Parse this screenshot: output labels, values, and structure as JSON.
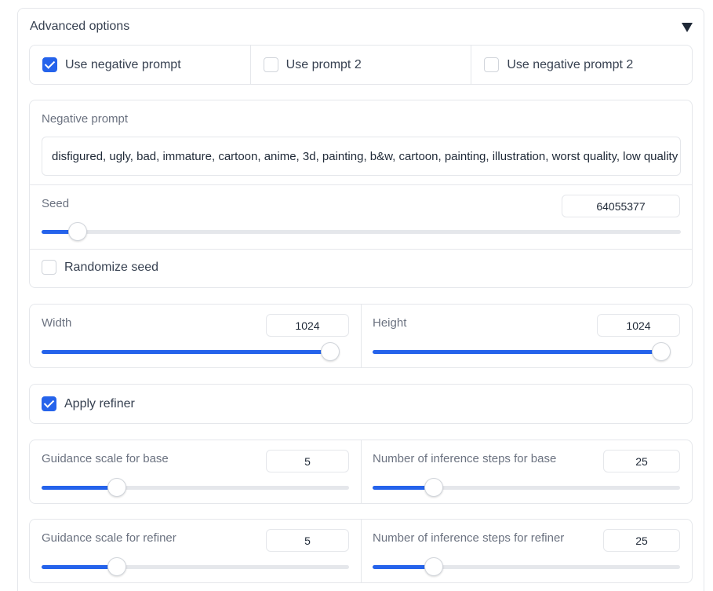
{
  "accordion": {
    "title": "Advanced options",
    "icon": "caret-down-icon"
  },
  "prompt_options": [
    {
      "label": "Use negative prompt",
      "checked": true
    },
    {
      "label": "Use prompt 2",
      "checked": false
    },
    {
      "label": "Use negative prompt 2",
      "checked": false
    }
  ],
  "negative_prompt": {
    "label": "Negative prompt",
    "value": "disfigured, ugly, bad, immature, cartoon, anime, 3d, painting, b&w, cartoon, painting, illustration, worst quality, low quality"
  },
  "seed": {
    "label": "Seed",
    "value": "64055377",
    "fraction": 0.043
  },
  "randomize_seed": {
    "label": "Randomize seed",
    "checked": false
  },
  "width": {
    "label": "Width",
    "value": "1024",
    "fraction": 1.0
  },
  "height": {
    "label": "Height",
    "value": "1024",
    "fraction": 1.0
  },
  "apply_refiner": {
    "label": "Apply refiner",
    "checked": true
  },
  "guidance_base": {
    "label": "Guidance scale for base",
    "value": "5",
    "fraction": 0.227
  },
  "steps_base": {
    "label": "Number of inference steps for base",
    "value": "25",
    "fraction": 0.18
  },
  "guidance_refiner": {
    "label": "Guidance scale for refiner",
    "value": "5",
    "fraction": 0.227
  },
  "steps_refiner": {
    "label": "Number of inference steps for refiner",
    "value": "25",
    "fraction": 0.18
  },
  "colors": {
    "accent": "#2563eb",
    "border": "#e5e7eb",
    "label": "#6b7280"
  }
}
